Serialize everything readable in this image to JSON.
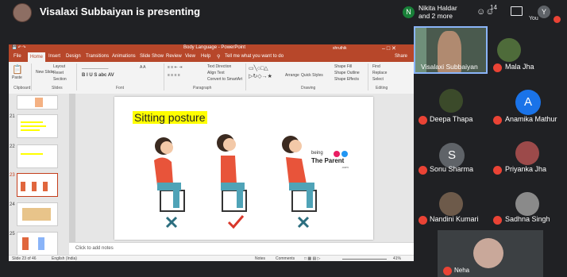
{
  "meet": {
    "presenter_banner": "Visalaxi Subbaiyan is presenting",
    "notification_initial": "N",
    "notification_line1": "Nikita Haldar",
    "notification_line2": "and 2 more",
    "people_count": "14",
    "you_initial": "Y",
    "you_label": "You",
    "people_icon": "people-icon",
    "chat_icon": "chat-icon"
  },
  "ppt": {
    "window_title": "Body Language - PowerPoint",
    "user_name": "shruthik",
    "menu": [
      "File",
      "Home",
      "Insert",
      "Design",
      "Transitions",
      "Animations",
      "Slide Show",
      "Review",
      "View",
      "Help"
    ],
    "tell_me": "Tell me what you want to do",
    "share": "Share",
    "ribbon": {
      "paste": "Paste",
      "new_slide": "New Slide",
      "layout": "Layout",
      "reset": "Reset",
      "section": "Section",
      "text_direction": "Text Direction",
      "align_text": "Align Text",
      "convert_smartart": "Convert to SmartArt",
      "arrange": "Arrange",
      "quick_styles": "Quick Styles",
      "shape_fill": "Shape Fill",
      "shape_outline": "Shape Outline",
      "shape_effects": "Shape Effects",
      "find": "Find",
      "replace": "Replace",
      "select": "Select",
      "groups": [
        "Clipboard",
        "Slides",
        "Font",
        "Paragraph",
        "Drawing",
        "Editing"
      ]
    },
    "thumbnails": [
      "21",
      "22",
      "23",
      "24",
      "25"
    ],
    "slide_title": "Sitting posture",
    "logo_line1": "being",
    "logo_line2": "The Parent",
    "logo_line3": ".com",
    "notes_placeholder": "Click to add notes",
    "status_slide": "Slide 23 of 46",
    "status_lang": "English (India)",
    "status_notes": "Notes",
    "status_comments": "Comments",
    "status_zoom": "41%"
  },
  "participants": [
    {
      "name": "Visalaxi Subbaiyan",
      "kind": "video"
    },
    {
      "name": "Mala Jha",
      "kind": "photo",
      "color": "#4e6b3a"
    },
    {
      "name": "Deepa Thapa",
      "kind": "photo",
      "color": "#3b4a2a"
    },
    {
      "name": "Anamika Mathur",
      "kind": "initial",
      "initial": "A",
      "color": "#1a73e8"
    },
    {
      "name": "Sonu Sharma",
      "kind": "initial",
      "initial": "S",
      "color": "#5f6368"
    },
    {
      "name": "Priyanka Jha",
      "kind": "photo",
      "color": "#9c4a4a"
    },
    {
      "name": "Nandini Kumari",
      "kind": "photo",
      "color": "#6d5a4a"
    },
    {
      "name": "Sadhna Singh",
      "kind": "photo",
      "color": "#8a8a8a"
    },
    {
      "name": "Neha",
      "kind": "photo",
      "color": "#c9a89a"
    }
  ]
}
